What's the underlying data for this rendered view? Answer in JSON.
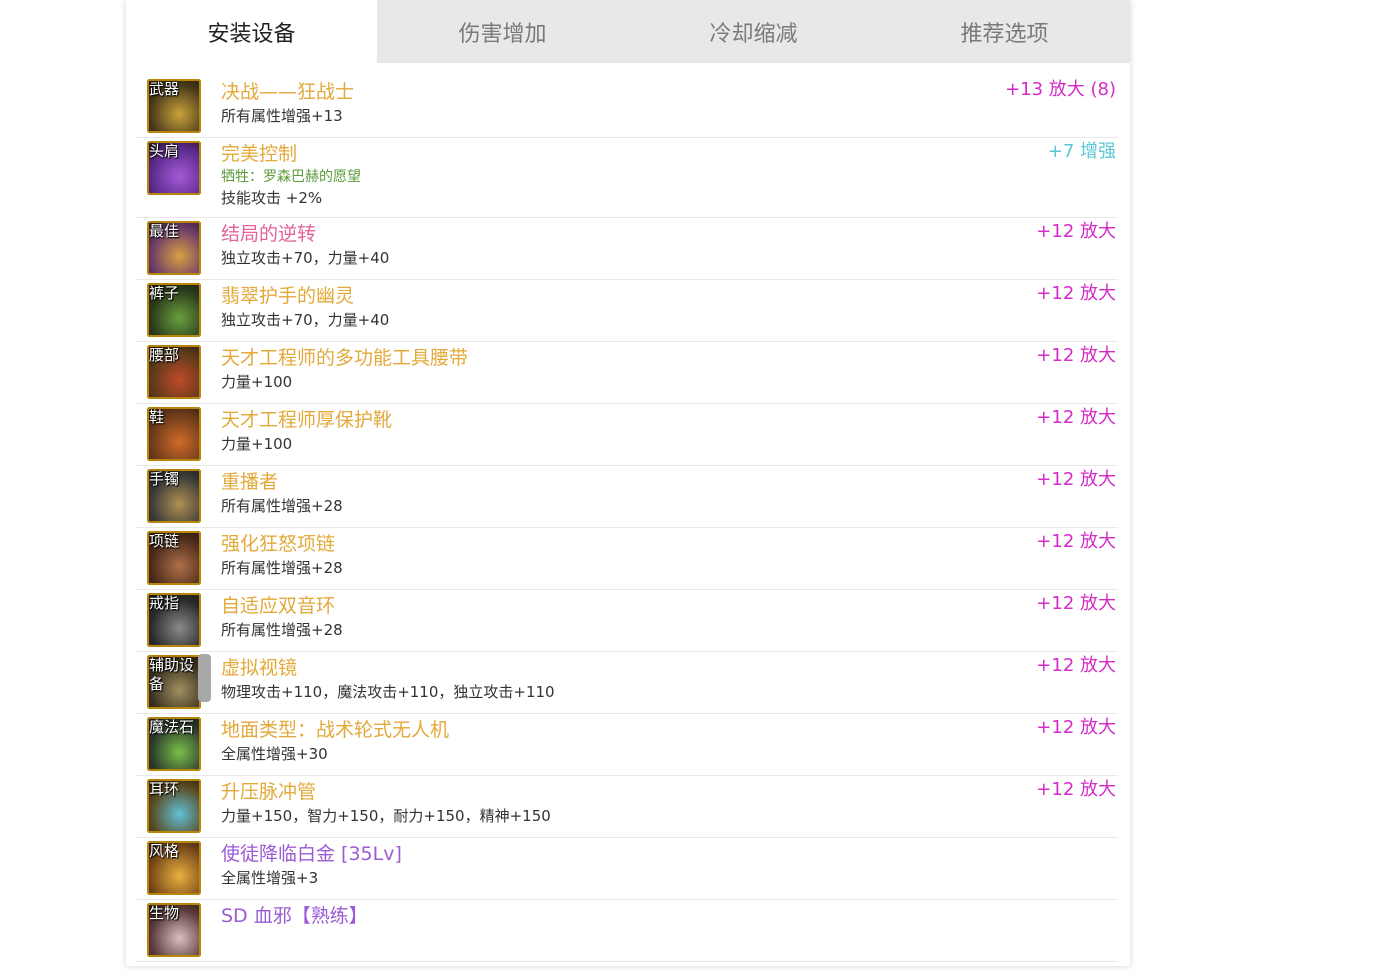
{
  "tabs": [
    "安装设备",
    "伤害增加",
    "冷却缩减",
    "推荐选项"
  ],
  "colors": {
    "epic_name": "#e3a93a",
    "legend_name": "#e3629d",
    "creature_name": "#9b5bd4",
    "amplify": "#d42bc8",
    "reinforce": "#5bc7d4",
    "soul_text": "#5b9b3a"
  },
  "equipment": [
    {
      "slot": "武器",
      "name": "决战——狂战士",
      "name_color": "#e3a93a",
      "sub": "",
      "attr": "所有属性增强+13",
      "upgrade": "+13 放大 (8)",
      "upgrade_color": "#d42bc8",
      "icon_bg": "#4a3a1c",
      "icon_accent": "#caa23a"
    },
    {
      "slot": "头肩",
      "name": "完美控制",
      "name_color": "#e3a93a",
      "sub": "牺牲：罗森巴赫的愿望",
      "attr": "技能攻击 +2%",
      "upgrade": "+7 增强",
      "upgrade_color": "#5bc7d4",
      "icon_bg": "#5a2a8a",
      "icon_accent": "#a35ad8"
    },
    {
      "slot": "最佳",
      "name": "结局的逆转",
      "name_color": "#e3629d",
      "sub": "",
      "attr": "独立攻击+70，力量+40",
      "upgrade": "+12 放大",
      "upgrade_color": "#d42bc8",
      "icon_bg": "#6a3a6a",
      "icon_accent": "#d8a040"
    },
    {
      "slot": "裤子",
      "name": "翡翠护手的幽灵",
      "name_color": "#e3a93a",
      "sub": "",
      "attr": "独立攻击+70，力量+40",
      "upgrade": "+12 放大",
      "upgrade_color": "#d42bc8",
      "icon_bg": "#2a3a1a",
      "icon_accent": "#6aa040"
    },
    {
      "slot": "腰部",
      "name": "天才工程师的多功能工具腰带",
      "name_color": "#e3a93a",
      "sub": "",
      "attr": "力量+100",
      "upgrade": "+12 放大",
      "upgrade_color": "#d42bc8",
      "icon_bg": "#5a3a1a",
      "icon_accent": "#c04a2a"
    },
    {
      "slot": "鞋",
      "name": "天才工程师厚保护靴",
      "name_color": "#e3a93a",
      "sub": "",
      "attr": "力量+100",
      "upgrade": "+12 放大",
      "upgrade_color": "#d42bc8",
      "icon_bg": "#6a3a1a",
      "icon_accent": "#d06a2a"
    },
    {
      "slot": "手镯",
      "name": "重播者",
      "name_color": "#e3a93a",
      "sub": "",
      "attr": "所有属性增强+28",
      "upgrade": "+12 放大",
      "upgrade_color": "#d42bc8",
      "icon_bg": "#3a3a3a",
      "icon_accent": "#b09050"
    },
    {
      "slot": "项链",
      "name": "强化狂怒项链",
      "name_color": "#e3a93a",
      "sub": "",
      "attr": "所有属性增强+28",
      "upgrade": "+12 放大",
      "upgrade_color": "#d42bc8",
      "icon_bg": "#4a2a1a",
      "icon_accent": "#b0704a"
    },
    {
      "slot": "戒指",
      "name": "自适应双音环",
      "name_color": "#e3a93a",
      "sub": "",
      "attr": "所有属性增强+28",
      "upgrade": "+12 放大",
      "upgrade_color": "#d42bc8",
      "icon_bg": "#2a2a2a",
      "icon_accent": "#8a8a8a"
    },
    {
      "slot": "辅助设备",
      "name": "虚拟视镜",
      "name_color": "#e3a93a",
      "sub": "",
      "attr": "物理攻击+110，魔法攻击+110，独立攻击+110",
      "upgrade": "+12 放大",
      "upgrade_color": "#d42bc8",
      "icon_bg": "#3a3020",
      "icon_accent": "#a09060",
      "scroll": true
    },
    {
      "slot": "魔法石",
      "name": "地面类型：战术轮式无人机",
      "name_color": "#e3a93a",
      "sub": "",
      "attr": "全属性增强+30",
      "upgrade": "+12 放大",
      "upgrade_color": "#d42bc8",
      "icon_bg": "#2a3a2a",
      "icon_accent": "#7ac04a"
    },
    {
      "slot": "耳环",
      "name": "升压脉冲管",
      "name_color": "#e3a93a",
      "sub": "",
      "attr": "力量+150，智力+150，耐力+150，精神+150",
      "upgrade": "+12 放大",
      "upgrade_color": "#d42bc8",
      "icon_bg": "#5a4a20",
      "icon_accent": "#60c0d8"
    },
    {
      "slot": "风格",
      "name": "使徒降临白金 [35Lv]",
      "name_color": "#9b5bd4",
      "sub": "",
      "attr": "全属性增强+3",
      "upgrade": "",
      "upgrade_color": "#d42bc8",
      "icon_bg": "#7a4a1a",
      "icon_accent": "#e8b040"
    },
    {
      "slot": "生物",
      "name": "SD 血邪【熟练】",
      "name_color": "#9b5bd4",
      "sub": "",
      "attr": "",
      "upgrade": "",
      "upgrade_color": "#d42bc8",
      "icon_bg": "#5a3a3a",
      "icon_accent": "#d8c0c0"
    }
  ]
}
